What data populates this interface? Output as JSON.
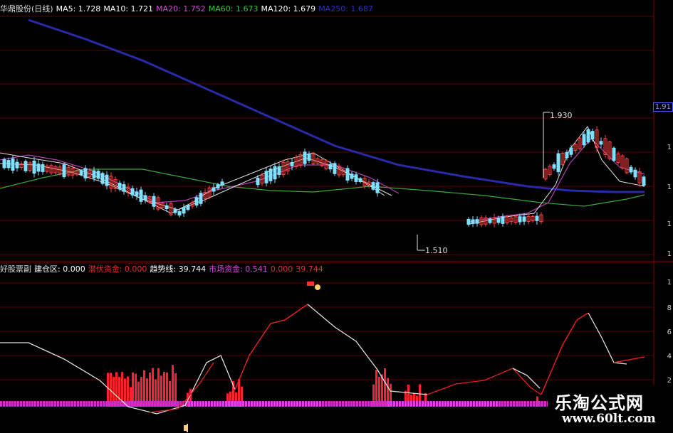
{
  "main_panel": {
    "legend": [
      {
        "text": "华鼎股份(日线)",
        "color": "#dddddd"
      },
      {
        "text": "MA5: 1.728",
        "color": "#ffffff"
      },
      {
        "text": "MA10: 1.721",
        "color": "#ffffff"
      },
      {
        "text": "MA20: 1.752",
        "color": "#d050d0"
      },
      {
        "text": "MA60: 1.673",
        "color": "#40c040"
      },
      {
        "text": "MA120: 1.679",
        "color": "#ffffff"
      },
      {
        "text": "MA250: 1.687",
        "color": "#3030c0"
      }
    ],
    "high_label": "1.930",
    "low_label": "1.510",
    "axis_badge": "1.91",
    "axis_ticks": [
      "1",
      "1",
      "1",
      "1"
    ]
  },
  "sub_panel": {
    "legend": [
      {
        "text": "好股票副",
        "color": "#dddddd"
      },
      {
        "text": "建仓区: 0.000",
        "color": "#ffffff"
      },
      {
        "text": "潜伏资金: 0.000",
        "color": "#e03030"
      },
      {
        "text": "趋势线: 39.744",
        "color": "#ffffff"
      },
      {
        "text": "市场资金: 0.541",
        "color": "#e040e0"
      },
      {
        "text": "0.000",
        "color": "#e03030"
      },
      {
        "text": "39.744",
        "color": "#e03030"
      }
    ],
    "axis_ticks": [
      "1",
      "8",
      "6",
      "4",
      "2"
    ]
  },
  "watermark": {
    "brand": "乐淘公式网",
    "url": "www.60lt.com"
  },
  "colors": {
    "grid": "#5a0000",
    "ma250": "#2a2aa8",
    "ma60": "#3aa83a",
    "ma20": "#b040b0",
    "ma_white": "#e0e0e0",
    "candle_up": "#ff4040",
    "candle_down": "#80e0ff",
    "trend_rise": "#e02020",
    "trend_fall": "#e0e0e0",
    "money_red": "#ff2030",
    "market_pink": "#e040e0"
  },
  "icons": [
    "candlestick-chart",
    "cursor-hand-icon",
    "signal-marker-icon"
  ]
}
